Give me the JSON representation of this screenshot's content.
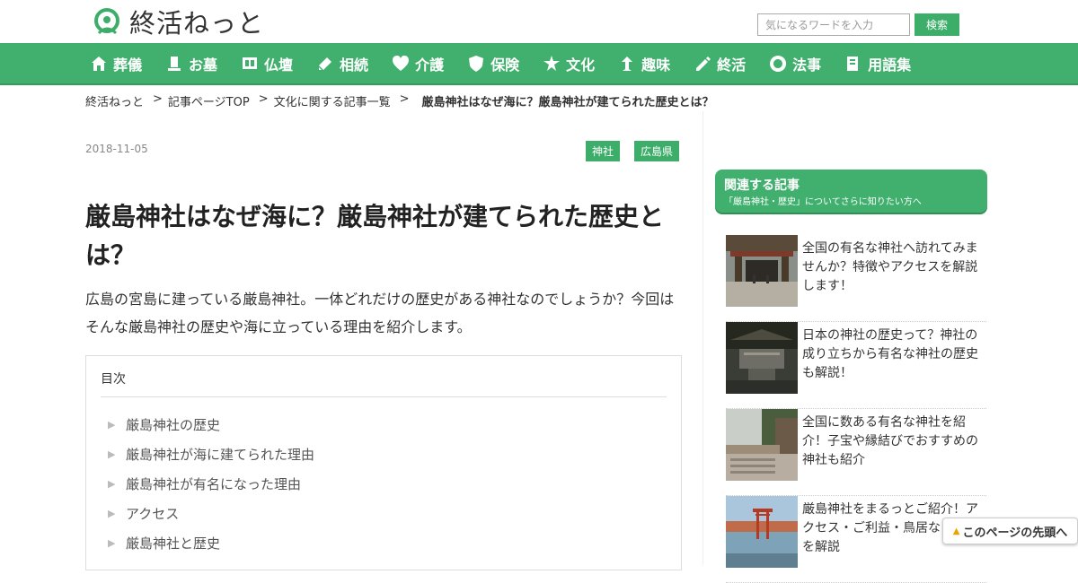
{
  "site": {
    "logo_text": "終活ねっと"
  },
  "search": {
    "placeholder": "気になるワードを入力",
    "button_label": "検索"
  },
  "nav": [
    {
      "label": "葬儀",
      "icon": "funeral-icon"
    },
    {
      "label": "お墓",
      "icon": "grave-icon"
    },
    {
      "label": "仏壇",
      "icon": "altar-icon"
    },
    {
      "label": "相続",
      "icon": "inheritance-icon"
    },
    {
      "label": "介護",
      "icon": "care-icon"
    },
    {
      "label": "保険",
      "icon": "insurance-icon"
    },
    {
      "label": "文化",
      "icon": "culture-icon"
    },
    {
      "label": "趣味",
      "icon": "hobby-icon"
    },
    {
      "label": "終活",
      "icon": "pencil-icon"
    },
    {
      "label": "法事",
      "icon": "memorial-icon"
    },
    {
      "label": "用語集",
      "icon": "glossary-icon"
    }
  ],
  "breadcrumb": [
    "終活ねっと",
    "記事ページTOP",
    "文化に関する記事一覧",
    "厳島神社はなぜ海に？厳島神社が建てられた歴史とは？"
  ],
  "breadcrumb_sep": ">",
  "article": {
    "date": "2018-11-05",
    "tags": [
      "神社",
      "広島県"
    ],
    "title": "厳島神社はなぜ海に？厳島神社が建てられた歴史とは？",
    "lead": "広島の宮島に建っている厳島神社。一体どれだけの歴史がある神社なのでしょうか？今回はそんな厳島神社の歴史や海に立っている理由を紹介します。"
  },
  "toc": {
    "heading": "目次",
    "items": [
      "厳島神社の歴史",
      "厳島神社が海に建てられた理由",
      "厳島神社が有名になった理由",
      "アクセス",
      "厳島神社と歴史"
    ]
  },
  "sidebar": {
    "heading": "関連する記事",
    "subheading": "「厳島神社・歴史」についてさらに知りたい方へ",
    "items": [
      {
        "text": "全国の有名な神社へ訪れてみませんか？特徴やアクセスを解説します！"
      },
      {
        "text": "日本の神社の歴史って？神社の成り立ちから有名な神社の歴史も解説！"
      },
      {
        "text": "全国に数ある有名な神社を紹介！子宝や縁結びでおすすめの神社も紹介"
      },
      {
        "text": "厳島神社をまるっとご紹介！アクセス・ご利益・鳥居など見所を解説"
      }
    ]
  },
  "pagetop": {
    "label": "このページの先頭へ"
  },
  "colors": {
    "brand_green": "#41b06e",
    "accent_yellow": "#e8a400"
  }
}
